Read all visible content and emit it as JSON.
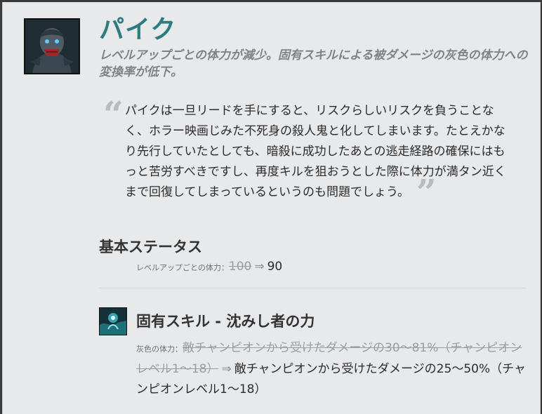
{
  "champion": {
    "name": "パイク",
    "summary": "レベルアップごとの体力が減少。固有スキルによる被ダメージの灰色の体力への変換率が低下。",
    "quote": "パイクは一旦リードを手にすると、リスクらしいリスクを負うことなく、ホラー映画じみた不死身の殺人鬼と化してしまいます。たとえかなり先行していたとしても、暗殺に成功したあとの逃走経路の確保にはもっと苦労すべきですし、再度キルを狙おうとした際に体力が満タン近くまで回復してしまっているというのも問題でしょう。",
    "quote_open": "“",
    "quote_close": "”"
  },
  "base_stats": {
    "title": "基本ステータス",
    "rows": [
      {
        "label": "レベルアップごとの体力：",
        "old": "100",
        "arrow": "⇒",
        "new": "90"
      }
    ]
  },
  "passive": {
    "title": "固有スキル - 沈みし者の力",
    "icon": "skill-passive-icon",
    "label": "灰色の体力：",
    "old": "敵チャンピオンから受けたダメージの30～81%（チャンピオンレベル1～18）",
    "arrow": "⇒",
    "new": "敵チャンピオンから受けたダメージの25～50%（チャンピオンレベル1～18）"
  },
  "colors": {
    "accent": "#2c7d7f",
    "panel_bg": "#e8e9eb",
    "text": "#2b2b2b",
    "muted": "#7f8388"
  }
}
